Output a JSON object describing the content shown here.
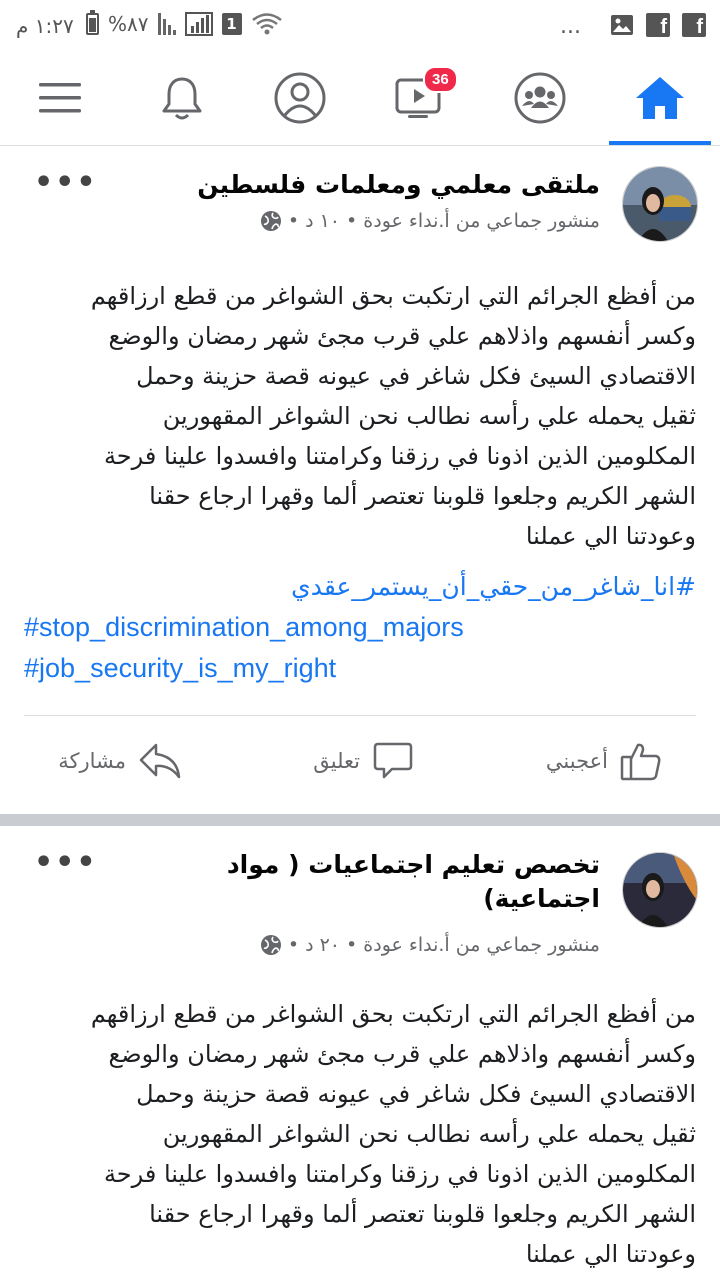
{
  "status_bar": {
    "time": "١:٢٧ م",
    "battery": "%٨٧",
    "sim_number": "1",
    "more": "...",
    "fb_glyph": "f"
  },
  "nav": {
    "items": [
      {
        "name": "menu",
        "icon": "hamburger-icon"
      },
      {
        "name": "notifications",
        "icon": "bell-icon"
      },
      {
        "name": "profile",
        "icon": "profile-icon"
      },
      {
        "name": "watch",
        "icon": "video-icon",
        "badge": "36"
      },
      {
        "name": "groups",
        "icon": "groups-icon"
      },
      {
        "name": "home",
        "icon": "home-icon",
        "active": true
      }
    ],
    "accent": "#1877f2",
    "badge_color": "#f02849"
  },
  "posts": [
    {
      "group": "ملتقى معلمي ومعلمات فلسطين",
      "meta": "منشور جماعي من أ.نداء عودة • ١٠ د •",
      "more": "•••",
      "body": "من أفظع الجرائم التي ارتكبت بحق الشواغر من قطع ارزاقهم\nوكسر أنفسهم واذلاهم علي قرب مجئ شهر رمضان والوضع\nالاقتصادي السيئ فكل شاغر  في عيونه  قصة حزينة وحمل\nثقيل يحمله علي رأسه نطالب نحن الشواغر المقهورين\nالمكلومين الذين اذونا في رزقنا وكرامتنا وافسدوا علينا فرحة\nالشهر الكريم وجلعوا قلوبنا تعتصر ألما وقهرا ارجاع حقنا\nوعودتنا الي عملنا",
      "hashtags": [
        "#انا_شاغر_من_حقي_أن_يستمر_عقدي",
        "#stop_discrimination_among_majors",
        "#job_security_is_my_right"
      ],
      "actions": {
        "like": "أعجبني",
        "comment": "تعليق",
        "share": "مشاركة"
      }
    },
    {
      "group_line1": "تخصص تعليم اجتماعيات ( مواد",
      "group_line2": "اجتماعية)",
      "meta": "منشور جماعي من أ.نداء عودة • ٢٠ د •",
      "more": "•••",
      "body": "من أفظع الجرائم التي ارتكبت بحق الشواغر من قطع ارزاقهم\nوكسر أنفسهم واذلاهم علي قرب مجئ شهر رمضان والوضع\nالاقتصادي السيئ فكل شاغر  في عيونه  قصة حزينة وحمل\nثقيل يحمله علي رأسه نطالب نحن الشواغر المقهورين\nالمكلومين الذين اذونا في رزقنا وكرامتنا وافسدوا علينا فرحة\nالشهر الكريم وجلعوا قلوبنا تعتصر ألما وقهرا ارجاع حقنا\nوعودتنا الي عملنا"
    }
  ],
  "colors": {
    "link": "#1877f2",
    "meta_text": "#65676b",
    "separator": "#c9ccd1"
  }
}
